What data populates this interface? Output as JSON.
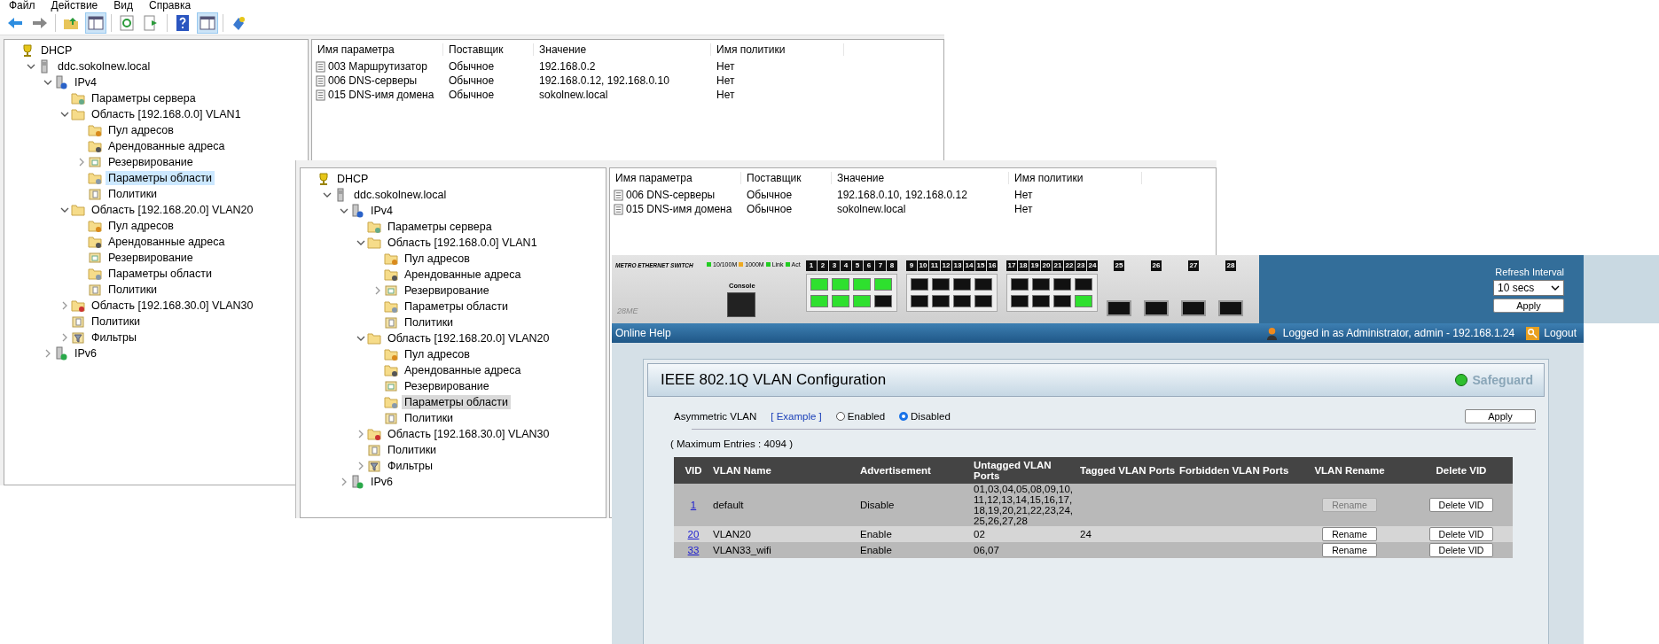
{
  "mmc_windows": [
    {
      "menu": [
        "Файл",
        "Действие",
        "Вид",
        "Справка"
      ],
      "focused": true,
      "tree": [
        {
          "label": "DHCP",
          "kind": "root",
          "selected": false,
          "children": [
            {
              "label": "ddc.sokolnew.local",
              "kind": "server",
              "expanded": true,
              "selected": false,
              "children": [
                {
                  "label": "IPv4",
                  "kind": "ipv4",
                  "expanded": true,
                  "selected": false,
                  "children": [
                    {
                      "label": "Параметры сервера",
                      "kind": "settings",
                      "selected": false
                    },
                    {
                      "label": "Область [192.168.0.0] VLAN1",
                      "kind": "folder",
                      "expanded": true,
                      "selected": false,
                      "children": [
                        {
                          "label": "Пул адресов",
                          "kind": "pool",
                          "selected": false
                        },
                        {
                          "label": "Арендованные адреса",
                          "kind": "leases",
                          "selected": false
                        },
                        {
                          "label": "Резервирование",
                          "kind": "reservation",
                          "expanded": false,
                          "selected": false
                        },
                        {
                          "label": "Параметры области",
                          "kind": "options",
                          "selected": true
                        },
                        {
                          "label": "Политики",
                          "kind": "policies",
                          "selected": false
                        }
                      ]
                    },
                    {
                      "label": "Область [192.168.20.0] VLAN20",
                      "kind": "folder",
                      "expanded": true,
                      "selected": false,
                      "children": [
                        {
                          "label": "Пул адресов",
                          "kind": "pool",
                          "selected": false
                        },
                        {
                          "label": "Арендованные адреса",
                          "kind": "leases",
                          "selected": false
                        },
                        {
                          "label": "Резервирование",
                          "kind": "reservation",
                          "selected": false
                        },
                        {
                          "label": "Параметры области",
                          "kind": "options",
                          "selected": false
                        },
                        {
                          "label": "Политики",
                          "kind": "policies",
                          "selected": false
                        }
                      ]
                    },
                    {
                      "label": "Область [192.168.30.0] VLAN30",
                      "kind": "scope-down",
                      "expanded": false,
                      "selected": false
                    },
                    {
                      "label": "Политики",
                      "kind": "policies",
                      "selected": false
                    },
                    {
                      "label": "Фильтры",
                      "kind": "filters",
                      "expanded": false,
                      "selected": false
                    }
                  ]
                },
                {
                  "label": "IPv6",
                  "kind": "ipv6",
                  "expanded": false,
                  "selected": false
                }
              ]
            }
          ]
        }
      ],
      "table": {
        "columns": [
          "Имя параметра",
          "Поставщик",
          "Значение",
          "Имя политики"
        ],
        "rows": [
          [
            "003 Маршрутизатор",
            "Обычное",
            "192.168.0.2",
            "Нет"
          ],
          [
            "006 DNS-серверы",
            "Обычное",
            "192.168.0.12, 192.168.0.10",
            "Нет"
          ],
          [
            "015 DNS-имя домена",
            "Обычное",
            "sokolnew.local",
            "Нет"
          ]
        ]
      }
    },
    {
      "focused": false,
      "tree": [
        {
          "label": "DHCP",
          "kind": "root",
          "selected": false,
          "children": [
            {
              "label": "ddc.sokolnew.local",
              "kind": "server",
              "expanded": true,
              "selected": false,
              "children": [
                {
                  "label": "IPv4",
                  "kind": "ipv4",
                  "expanded": true,
                  "selected": false,
                  "children": [
                    {
                      "label": "Параметры сервера",
                      "kind": "settings",
                      "selected": false
                    },
                    {
                      "label": "Область [192.168.0.0] VLAN1",
                      "kind": "folder",
                      "expanded": true,
                      "selected": false,
                      "children": [
                        {
                          "label": "Пул адресов",
                          "kind": "pool",
                          "selected": false
                        },
                        {
                          "label": "Арендованные адреса",
                          "kind": "leases",
                          "selected": false
                        },
                        {
                          "label": "Резервирование",
                          "kind": "reservation",
                          "expanded": false,
                          "selected": false
                        },
                        {
                          "label": "Параметры области",
                          "kind": "options",
                          "selected": false
                        },
                        {
                          "label": "Политики",
                          "kind": "policies",
                          "selected": false
                        }
                      ]
                    },
                    {
                      "label": "Область [192.168.20.0] VLAN20",
                      "kind": "folder",
                      "expanded": true,
                      "selected": false,
                      "children": [
                        {
                          "label": "Пул адресов",
                          "kind": "pool",
                          "selected": false
                        },
                        {
                          "label": "Арендованные адреса",
                          "kind": "leases",
                          "selected": false
                        },
                        {
                          "label": "Резервирование",
                          "kind": "reservation",
                          "selected": false
                        },
                        {
                          "label": "Параметры области",
                          "kind": "options",
                          "selected": true
                        },
                        {
                          "label": "Политики",
                          "kind": "policies",
                          "selected": false
                        }
                      ]
                    },
                    {
                      "label": "Область [192.168.30.0] VLAN30",
                      "kind": "scope-down",
                      "expanded": false,
                      "selected": false
                    },
                    {
                      "label": "Политики",
                      "kind": "policies",
                      "selected": false
                    },
                    {
                      "label": "Фильтры",
                      "kind": "filters",
                      "expanded": false,
                      "selected": false
                    }
                  ]
                },
                {
                  "label": "IPv6",
                  "kind": "ipv6",
                  "expanded": false,
                  "selected": false
                }
              ]
            }
          ]
        }
      ],
      "table": {
        "columns": [
          "Имя параметра",
          "Поставщик",
          "Значение",
          "Имя политики"
        ],
        "rows": [
          [
            "006 DNS-серверы",
            "Обычное",
            "192.168.0.10, 192.168.0.12",
            "Нет"
          ],
          [
            "015 DNS-имя домена",
            "Обычное",
            "sokolnew.local",
            "Нет"
          ]
        ]
      }
    }
  ],
  "switch_web": {
    "device": {
      "title": "METRO ETHERNET SWITCH",
      "legend": [
        "10/100M",
        "1000M",
        "Link",
        "Act"
      ],
      "console": "Console",
      "model": "28ME",
      "port_groups": [
        {
          "kind": "rj45",
          "ports": [
            {
              "number": "1",
              "link": true
            },
            {
              "number": "2",
              "link": true
            },
            {
              "number": "3",
              "link": true
            },
            {
              "number": "4",
              "link": true
            },
            {
              "number": "5",
              "link": true
            },
            {
              "number": "6",
              "link": true
            },
            {
              "number": "7",
              "link": true
            },
            {
              "number": "8",
              "link": false
            }
          ]
        },
        {
          "kind": "rj45",
          "ports": [
            {
              "number": "9",
              "link": false
            },
            {
              "number": "10",
              "link": false
            },
            {
              "number": "11",
              "link": false
            },
            {
              "number": "12",
              "link": false
            },
            {
              "number": "13",
              "link": false
            },
            {
              "number": "14",
              "link": false
            },
            {
              "number": "15",
              "link": false
            },
            {
              "number": "16",
              "link": false
            }
          ]
        },
        {
          "kind": "rj45",
          "ports": [
            {
              "number": "17",
              "link": false
            },
            {
              "number": "18",
              "link": false
            },
            {
              "number": "19",
              "link": false
            },
            {
              "number": "20",
              "link": false
            },
            {
              "number": "21",
              "link": false
            },
            {
              "number": "22",
              "link": false
            },
            {
              "number": "23",
              "link": false
            },
            {
              "number": "24",
              "link": true
            }
          ]
        },
        {
          "kind": "sfp",
          "ports": [
            {
              "number": "25",
              "link": false
            },
            {
              "number": "26",
              "link": false
            },
            {
              "number": "27",
              "link": false
            },
            {
              "number": "28",
              "link": false
            }
          ]
        }
      ]
    },
    "refresh": {
      "label": "Refresh Interval",
      "value": "10 secs",
      "apply": "Apply"
    },
    "help_bar": {
      "online_help": "Online Help",
      "login": "Logged in as Administrator, admin - 192.168.1.24",
      "logout": "Logout"
    },
    "vlan_config": {
      "title": "IEEE 802.1Q VLAN Configuration",
      "safeguard": {
        "label": "Safeguard",
        "color": "#2fbf2f"
      },
      "asymmetric_label": "Asymmetric VLAN",
      "example_link": "[ Example ]",
      "options": [
        {
          "label": "Enabled",
          "selected": false
        },
        {
          "label": "Disabled",
          "selected": true
        }
      ],
      "apply": "Apply",
      "max_entries": "( Maximum Entries : 4094 )",
      "columns": [
        "VID",
        "VLAN Name",
        "Advertisement",
        "Untagged VLAN Ports",
        "Tagged VLAN Ports",
        "Forbidden VLAN Ports",
        "VLAN Rename",
        "Delete VID"
      ],
      "rows": [
        {
          "vid": "1",
          "name": "default",
          "advertisement": "Disable",
          "untagged": "01,03,04,05,08,09,10,11,12,13,14,15,16,17,18,19,20,21,22,23,24,25,26,27,28",
          "tagged": "",
          "forbidden": "",
          "rename": "Rename",
          "rename_disabled": true,
          "delete": "Delete VID"
        },
        {
          "vid": "20",
          "name": "VLAN20",
          "advertisement": "Enable",
          "untagged": "02",
          "tagged": "24",
          "forbidden": "",
          "rename": "Rename",
          "rename_disabled": false,
          "delete": "Delete VID"
        },
        {
          "vid": "33",
          "name": "VLAN33_wifi",
          "advertisement": "Enable",
          "untagged": "06,07",
          "tagged": "",
          "forbidden": "",
          "rename": "Rename",
          "rename_disabled": false,
          "delete": "Delete VID"
        }
      ]
    }
  }
}
